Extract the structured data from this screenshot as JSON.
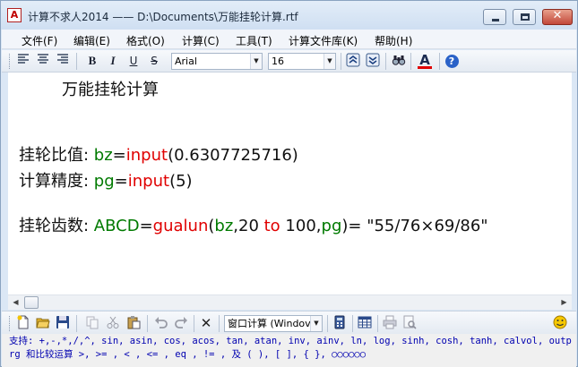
{
  "window": {
    "title": "计算不求人2014 —— D:\\Documents\\万能挂轮计算.rtf",
    "app_icon_letter": "A"
  },
  "menu": [
    "文件(F)",
    "编辑(E)",
    "格式(O)",
    "计算(C)",
    "工具(T)",
    "计算文件库(K)",
    "帮助(H)"
  ],
  "format_toolbar": {
    "font_name": "Arial",
    "font_size": "16",
    "bold": "B",
    "italic": "I",
    "underline": "U",
    "strike": "S",
    "font_color_label": "A",
    "help": "?"
  },
  "document": {
    "heading": "万能挂轮计算",
    "line1": {
      "label": "挂轮比值: ",
      "var": "bz",
      "eq": "=",
      "fn": "input",
      "args": "(0.6307725716)"
    },
    "line2": {
      "label": "计算精度: ",
      "var": "pg",
      "eq": "=",
      "fn": "input",
      "args": "(5)"
    },
    "line3": {
      "label": "挂轮齿数: ",
      "var": "ABCD",
      "eq": "=",
      "fn": "gualun",
      "open": "(",
      "arg1": "bz",
      "arg2": ",20 ",
      "kw": "to",
      "arg3": " 100,",
      "arg4": "pg",
      "close": ")= ",
      "result": "\"55/76×69/86\""
    }
  },
  "bottom_toolbar": {
    "window_combo": "窗口计算 (Windov"
  },
  "help_text": "支持: +,-,*,/,^, sin, asin, cos, acos, tan, atan, inv, ainv, ln, log, sinh, cosh, tanh, calvol, outprg 和比较运算 >, >= , < , <= , eq , != , 及 ( ), [ ], { }, ○○○○○○",
  "colors": {
    "variable": "#007a00",
    "function": "#e00000",
    "help_text": "#0000b0"
  }
}
